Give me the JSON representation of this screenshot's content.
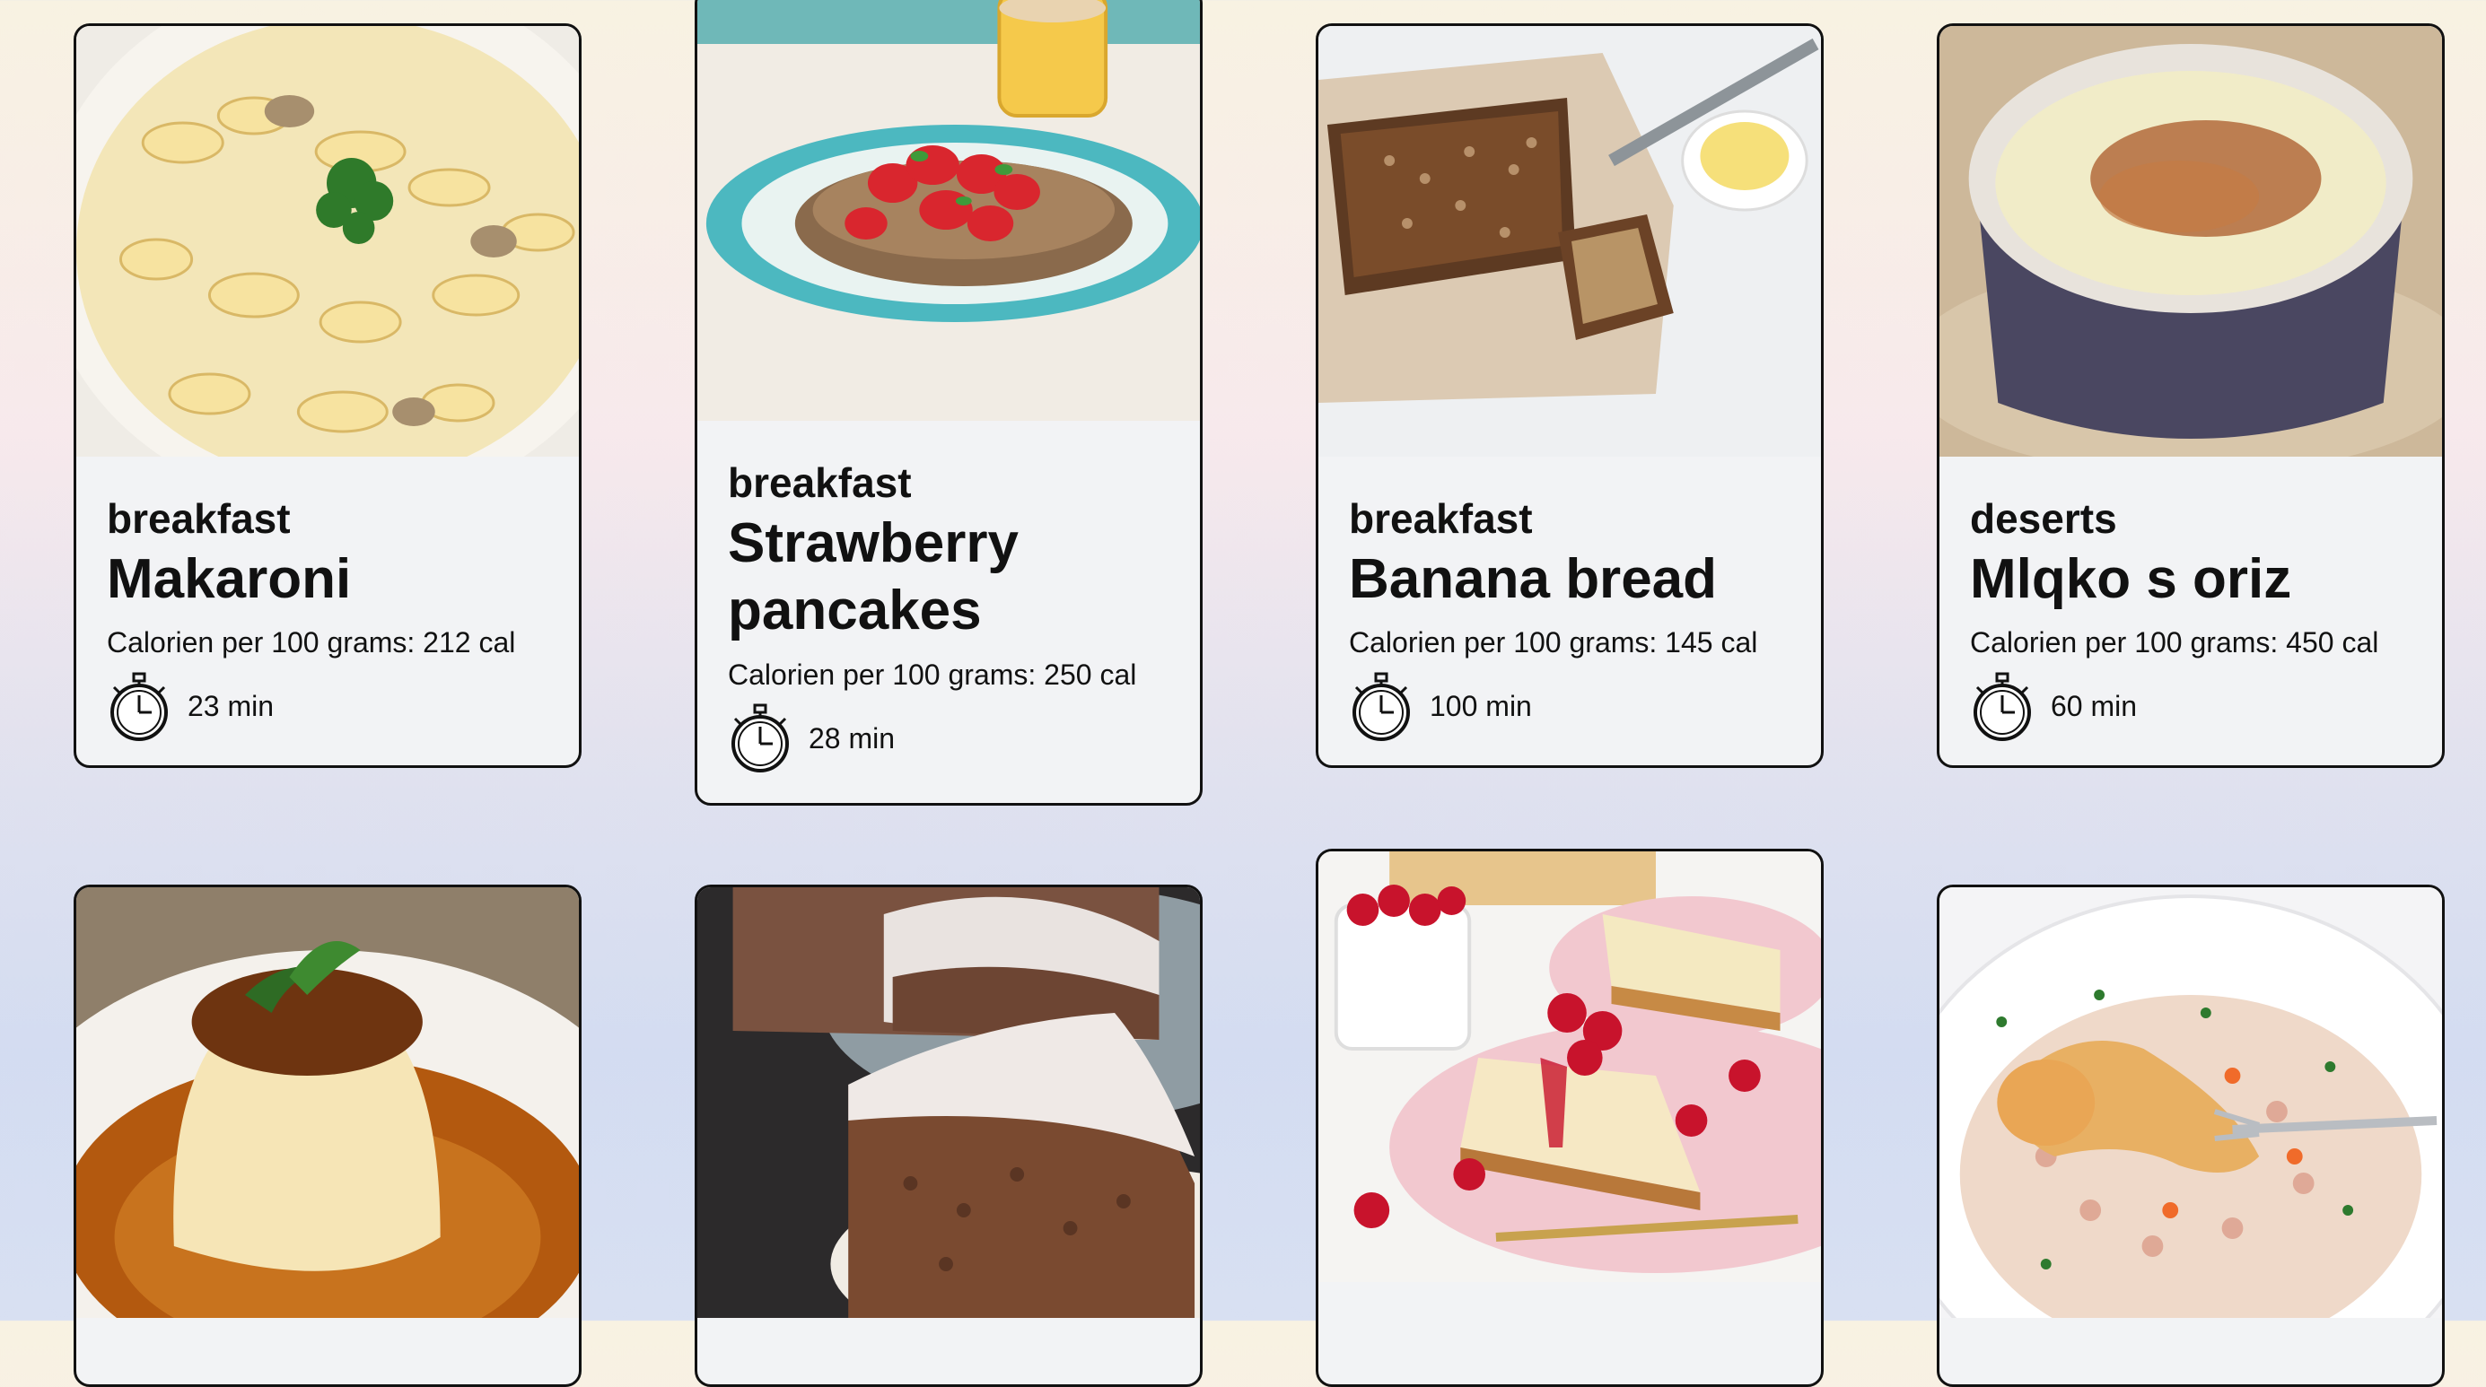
{
  "recipes": [
    {
      "category": "breakfast",
      "title": "Makaroni",
      "calories": "Calorien per 100 grams: 212 cal",
      "time": "23 min",
      "photo": "mac-and-cheese-photo"
    },
    {
      "category": "breakfast",
      "title": "Strawberry pancakes",
      "calories": "Calorien per 100 grams: 250 cal",
      "time": "28 min",
      "photo": "strawberry-pancakes-photo"
    },
    {
      "category": "breakfast",
      "title": "Banana bread",
      "calories": "Calorien per 100 grams: 145 cal",
      "time": "100 min",
      "photo": "banana-bread-photo"
    },
    {
      "category": "deserts",
      "title": "Mlqko s oriz",
      "calories": "Calorien per 100 grams: 450 cal",
      "time": "60 min",
      "photo": "rice-pudding-photo"
    },
    {
      "photo": "creme-caramel-photo"
    },
    {
      "photo": "walnut-cake-photo"
    },
    {
      "photo": "raspberry-cheesecake-photo"
    },
    {
      "photo": "chicken-rice-photo"
    }
  ],
  "icons": {
    "timer": "stopwatch-icon"
  }
}
